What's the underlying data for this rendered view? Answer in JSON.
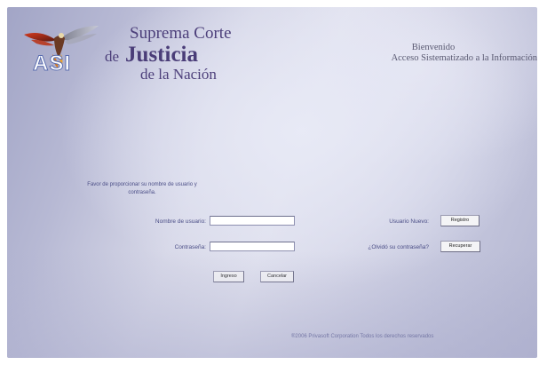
{
  "header": {
    "logo_text": "ASI",
    "court_line1": "Suprema Corte",
    "court_de": "de",
    "court_justicia": "Justicia",
    "court_line3": "de la Nación",
    "welcome_line1": "Bienvenido",
    "welcome_line2": "Acceso Sistematizado a la Información"
  },
  "form": {
    "instructions": "Favor de proporcionar su nombre de usuario y contraseña.",
    "username_label": "Nombre de usuario:",
    "username_value": "",
    "password_label": "Contraseña:",
    "password_value": "",
    "login_button": "Ingreso",
    "cancel_button": "Cancelar"
  },
  "side": {
    "new_user_label": "Usuario Nuevo:",
    "register_button": "Registro",
    "forgot_label": "¿Olvidó su contraseña?",
    "recover_button": "Recuperar"
  },
  "footer": {
    "copyright": "®2006 Privasoft Corporation Todos los derechos reservados"
  },
  "colors": {
    "text_accent": "#4a4d86",
    "title": "#4c3f7a",
    "background_light": "#e0e1ee",
    "background_dark": "#a2a5c6"
  },
  "icons": {
    "logo": "eagle-emblem-icon"
  }
}
